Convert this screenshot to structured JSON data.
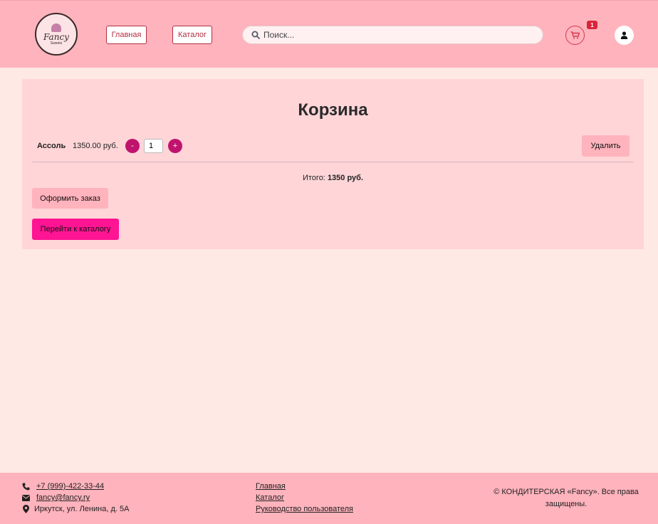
{
  "header": {
    "logo": {
      "brand": "Fancy",
      "sub": "Sweets"
    },
    "nav": [
      {
        "label": "Главная"
      },
      {
        "label": "Каталог"
      }
    ],
    "search": {
      "placeholder": "Поиск..."
    },
    "cart_count": "1",
    "icons": {
      "search": "search-icon",
      "cart": "cart-icon",
      "user": "user-icon"
    },
    "colors": {
      "bg": "#ffb3bd",
      "accent": "#b3303f",
      "badge": "#d9243a"
    }
  },
  "cart": {
    "title": "Корзина",
    "items": [
      {
        "name": "Ассоль",
        "price": "1350.00 руб.",
        "minus": "-",
        "quantity": "1",
        "plus": "+",
        "delete_label": "Удалить"
      }
    ],
    "total_label": "Итого:",
    "total_value": "1350 руб.",
    "order_label": "Оформить заказ",
    "catalog_label": "Перейти к каталогу",
    "colors": {
      "panel": "#ffd5d8",
      "qty_btn": "#c0136d",
      "primary": "#ff1493"
    }
  },
  "footer": {
    "contacts": {
      "phone": "+7 (999)-422-33-44",
      "email": "fancy@fancy.ry",
      "address": "Иркутск, ул. Ленина, д. 5А"
    },
    "links": [
      "Главная",
      "Каталог",
      "Руководство пользователя"
    ],
    "copyright": "© КОНДИТЕРСКАЯ «Fancy». Все права защищены."
  }
}
